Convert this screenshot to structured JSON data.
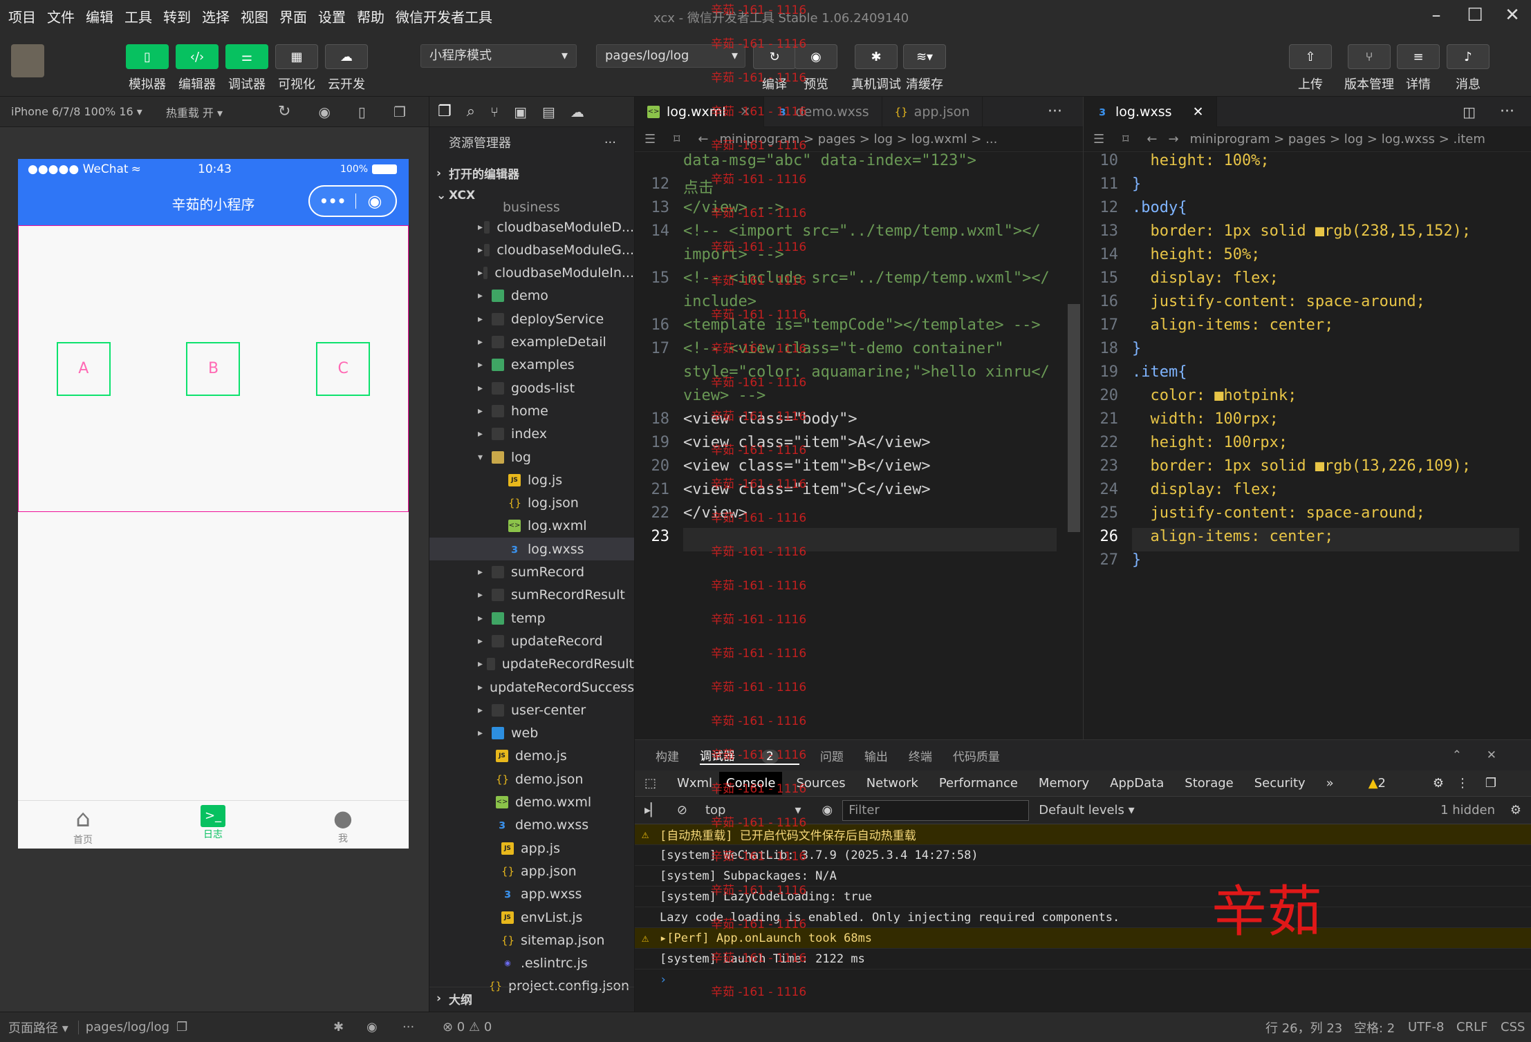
{
  "menu": [
    "项目",
    "文件",
    "编辑",
    "工具",
    "转到",
    "选择",
    "视图",
    "界面",
    "设置",
    "帮助",
    "微信开发者工具"
  ],
  "title": "xcx - 微信开发者工具 Stable 1.06.2409140",
  "toolbar": {
    "buttons_left": [
      "模拟器",
      "编辑器",
      "调试器",
      "可视化",
      "云开发"
    ],
    "mode_select": "小程序模式",
    "page_select": "pages/log/log",
    "buttons_mid": [
      "编译",
      "预览",
      "真机调试",
      "清缓存"
    ],
    "buttons_right": [
      "上传",
      "版本管理",
      "详情",
      "消息"
    ]
  },
  "simbar": {
    "device": "iPhone 6/7/8 100% 16 ▾",
    "hotreload": "热重载 开 ▾"
  },
  "phone": {
    "carrier": "●●●●● WeChat",
    "time": "10:43",
    "battery": "100%",
    "nav_title": "辛茹的小程序",
    "items": [
      "A",
      "B",
      "C"
    ],
    "tabs": [
      "首页",
      "日志",
      "我"
    ]
  },
  "explorer": {
    "title": "资源管理器",
    "open_editors": "打开的编辑器",
    "project": "XCX",
    "partial": "business",
    "rows": [
      {
        "label": "cloudbaseModuleD...",
        "type": "folder",
        "depth": 1
      },
      {
        "label": "cloudbaseModuleG...",
        "type": "folder",
        "depth": 1
      },
      {
        "label": "cloudbaseModuleIn...",
        "type": "folder",
        "depth": 1
      },
      {
        "label": "demo",
        "type": "folder-g",
        "depth": 1
      },
      {
        "label": "deployService",
        "type": "folder",
        "depth": 1
      },
      {
        "label": "exampleDetail",
        "type": "folder",
        "depth": 1
      },
      {
        "label": "examples",
        "type": "folder-g",
        "depth": 1
      },
      {
        "label": "goods-list",
        "type": "folder",
        "depth": 1
      },
      {
        "label": "home",
        "type": "folder",
        "depth": 1
      },
      {
        "label": "index",
        "type": "folder",
        "depth": 1
      },
      {
        "label": "log",
        "type": "folder-open",
        "depth": 1
      },
      {
        "label": "log.js",
        "type": "js",
        "depth": 2
      },
      {
        "label": "log.json",
        "type": "json",
        "depth": 2
      },
      {
        "label": "log.wxml",
        "type": "wxml",
        "depth": 2
      },
      {
        "label": "log.wxss",
        "type": "wxss",
        "depth": 2
      },
      {
        "label": "sumRecord",
        "type": "folder",
        "depth": 1
      },
      {
        "label": "sumRecordResult",
        "type": "folder",
        "depth": 1
      },
      {
        "label": "temp",
        "type": "folder-g",
        "depth": 1
      },
      {
        "label": "updateRecord",
        "type": "folder",
        "depth": 1
      },
      {
        "label": "updateRecordResult",
        "type": "folder",
        "depth": 1
      },
      {
        "label": "updateRecordSuccess",
        "type": "folder",
        "depth": 1
      },
      {
        "label": "user-center",
        "type": "folder",
        "depth": 1
      },
      {
        "label": "web",
        "type": "folder-b",
        "depth": 1
      },
      {
        "label": "demo.js",
        "type": "js",
        "depth": 1
      },
      {
        "label": "demo.json",
        "type": "json",
        "depth": 1
      },
      {
        "label": "demo.wxml",
        "type": "wxml",
        "depth": 1
      },
      {
        "label": "demo.wxss",
        "type": "wxss",
        "depth": 1
      },
      {
        "label": "app.js",
        "type": "js",
        "depth": 0
      },
      {
        "label": "app.json",
        "type": "json",
        "depth": 0
      },
      {
        "label": "app.wxss",
        "type": "wxss",
        "depth": 0
      },
      {
        "label": "envList.js",
        "type": "js",
        "depth": 0
      },
      {
        "label": "sitemap.json",
        "type": "json",
        "depth": 0
      },
      {
        "label": ".eslintrc.js",
        "type": "eslint",
        "depth": 0
      },
      {
        "label": "project.config.json",
        "type": "json",
        "depth": -1
      }
    ],
    "outline": "大纲"
  },
  "editor1": {
    "tabs": [
      "log.wxml",
      "demo.wxss",
      "app.json"
    ],
    "crumbs": "miniprogram > pages > log > log.wxml > ...",
    "lines": [
      {
        "n": "",
        "t": "data-msg=\"abc\" data-index=\"123\">"
      },
      {
        "n": "12",
        "t": "点击"
      },
      {
        "n": "13",
        "t": "</view> -->"
      },
      {
        "n": "14",
        "t": "<!-- <import src=\"../temp/temp.wxml\"></"
      },
      {
        "n": "",
        "t": "import> -->"
      },
      {
        "n": "15",
        "t": "<!-- <include src=\"../temp/temp.wxml\"></"
      },
      {
        "n": "",
        "t": "include>"
      },
      {
        "n": "16",
        "t": "<template is=\"tempCode\"></template> -->"
      },
      {
        "n": "17",
        "t": "<!-- <view class=\"t-demo container\""
      },
      {
        "n": "",
        "t": "style=\"color: aquamarine;\">hello xinru</"
      },
      {
        "n": "",
        "t": "view> -->"
      },
      {
        "n": "18",
        "t": "<view class=\"body\">"
      },
      {
        "n": "19",
        "t": "<view class=\"item\">A</view>"
      },
      {
        "n": "20",
        "t": "<view class=\"item\">B</view>"
      },
      {
        "n": "21",
        "t": "<view class=\"item\">C</view>"
      },
      {
        "n": "22",
        "t": "</view>"
      },
      {
        "n": "23",
        "t": ""
      }
    ]
  },
  "editor2": {
    "tab": "log.wxss",
    "crumbs": "miniprogram > pages > log > log.wxss > .item",
    "lines": [
      {
        "n": "10",
        "t": "  height: 100%;"
      },
      {
        "n": "11",
        "t": "}"
      },
      {
        "n": "12",
        "t": ".body{"
      },
      {
        "n": "13",
        "t": "  border: 1px solid ■rgb(238,15,152);"
      },
      {
        "n": "14",
        "t": "  height: 50%;"
      },
      {
        "n": "15",
        "t": "  display: flex;"
      },
      {
        "n": "16",
        "t": "  justify-content: space-around;"
      },
      {
        "n": "17",
        "t": "  align-items: center;"
      },
      {
        "n": "18",
        "t": "}"
      },
      {
        "n": "19",
        "t": ".item{"
      },
      {
        "n": "20",
        "t": "  color: ■hotpink;"
      },
      {
        "n": "21",
        "t": "  width: 100rpx;"
      },
      {
        "n": "22",
        "t": "  height: 100rpx;"
      },
      {
        "n": "23",
        "t": "  border: 1px solid ■rgb(13,226,109);"
      },
      {
        "n": "24",
        "t": "  display: flex;"
      },
      {
        "n": "25",
        "t": "  justify-content: space-around;"
      },
      {
        "n": "26",
        "t": "  align-items: center;"
      },
      {
        "n": "27",
        "t": "}"
      }
    ]
  },
  "debug": {
    "tabs": [
      "构建",
      "调试器",
      "2",
      "问题",
      "输出",
      "终端",
      "代码质量"
    ],
    "devtabs": [
      "Wxml",
      "Console",
      "Sources",
      "Network",
      "Performance",
      "Memory",
      "AppData",
      "Storage",
      "Security",
      "»"
    ],
    "warn_count": "2",
    "context": "top",
    "filter_placeholder": "Filter",
    "levels": "Default levels ▾",
    "hidden": "1 hidden",
    "console": [
      {
        "w": true,
        "t": "[自动热重载] 已开启代码文件保存后自动热重载"
      },
      {
        "w": false,
        "t": "[system] WeChatLib: 3.7.9 (2025.3.4 14:27:58)"
      },
      {
        "w": false,
        "t": "[system] Subpackages: N/A"
      },
      {
        "w": false,
        "t": "[system] LazyCodeLoading: true"
      },
      {
        "w": false,
        "t": "Lazy code loading is enabled. Only injecting required components."
      },
      {
        "w": true,
        "t": "▸[Perf] App.onLaunch took 68ms"
      },
      {
        "w": false,
        "t": "[system] Launch Time: 2122 ms"
      }
    ]
  },
  "statusline": {
    "path_label": "页面路径 ▾",
    "path": "pages/log/log",
    "errors": "⊗ 0 ⚠ 0",
    "pos": "行 26，列 23",
    "spaces": "空格: 2",
    "enc": "UTF-8",
    "eol": "CRLF",
    "lang": "CSS"
  },
  "watermark": "辛茹 -161 - 1116",
  "big_watermark": "辛茹",
  "colors": {
    "accent": "#07c160",
    "nav": "#2f76f6",
    "pink": "#ee0f98",
    "green": "#0de26d"
  }
}
